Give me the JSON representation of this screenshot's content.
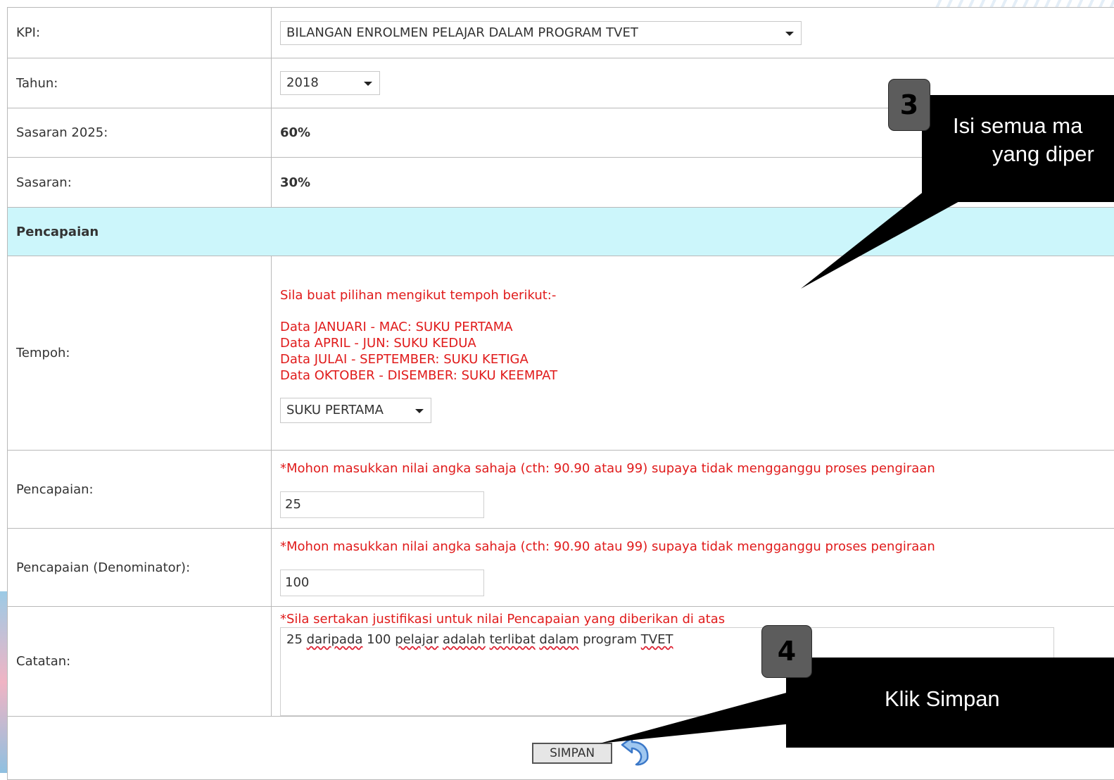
{
  "form": {
    "kpi": {
      "label": "KPI:",
      "value": "BILANGAN ENROLMEN PELAJAR DALAM PROGRAM TVET"
    },
    "tahun": {
      "label": "Tahun:",
      "value": "2018"
    },
    "sasaran_2025": {
      "label": "Sasaran 2025:",
      "value": "60%"
    },
    "sasaran": {
      "label": "Sasaran:",
      "value": "30%"
    },
    "section_title": "Pencapaian",
    "tempoh": {
      "label": "Tempoh:",
      "instruction": "Sila buat pilihan mengikut tempoh berikut:-",
      "lines": [
        "Data JANUARI - MAC: SUKU PERTAMA",
        "Data APRIL - JUN: SUKU KEDUA",
        "Data JULAI - SEPTEMBER: SUKU KETIGA",
        "Data OKTOBER - DISEMBER: SUKU KEEMPAT"
      ],
      "selected": "SUKU PERTAMA"
    },
    "pencapaian": {
      "label": "Pencapaian:",
      "note": "*Mohon masukkan nilai angka sahaja (cth: 90.90 atau 99) supaya tidak mengganggu proses pengiraan",
      "value": "25"
    },
    "denominator": {
      "label": "Pencapaian (Denominator):",
      "note": "*Mohon masukkan nilai angka sahaja (cth: 90.90 atau 99) supaya tidak mengganggu proses pengiraan",
      "value": "100"
    },
    "catatan": {
      "label": "Catatan:",
      "note": "*Sila sertakan justifikasi untuk nilai Pencapaian yang diberikan di atas",
      "words": [
        "25",
        "daripada",
        "100",
        "pelajar",
        "adalah",
        "terlibat",
        "dalam",
        "program",
        "TVET"
      ]
    },
    "save_label": "SIMPAN"
  },
  "callouts": {
    "step3": {
      "number": "3",
      "line1": "Isi semua ma",
      "line2": "yang diper"
    },
    "step4": {
      "number": "4",
      "text": "Klik Simpan"
    }
  },
  "icons": {
    "undo": "undo-arrow-icon",
    "dropdown": "chevron-down-icon"
  },
  "colors": {
    "section_bg": "#ccf6fb",
    "instruction_red": "#e01b1b",
    "callout_bg": "#000000",
    "badge_bg": "#5c5c5c"
  }
}
